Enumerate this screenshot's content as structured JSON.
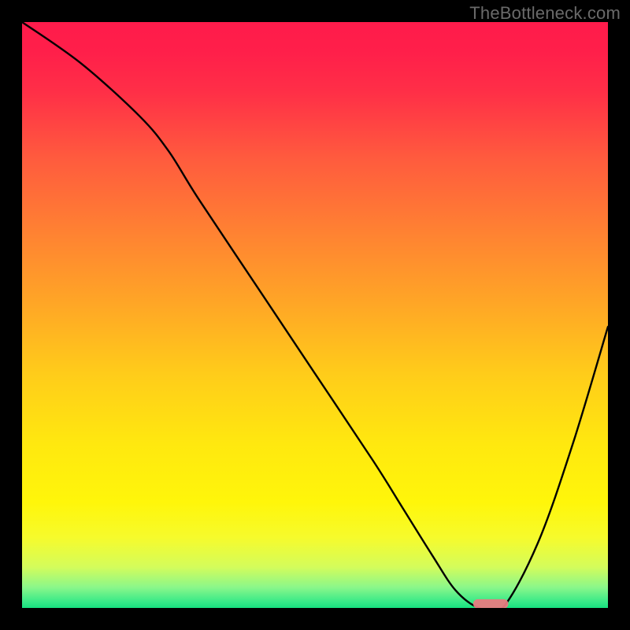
{
  "watermark": "TheBottleneck.com",
  "chart_data": {
    "type": "line",
    "title": "",
    "xlabel": "",
    "ylabel": "",
    "xlim": [
      0,
      100
    ],
    "ylim": [
      0,
      100
    ],
    "background_gradient": {
      "stops": [
        {
          "offset": 0.0,
          "color": "#ff1b4b"
        },
        {
          "offset": 0.05,
          "color": "#ff1f4a"
        },
        {
          "offset": 0.12,
          "color": "#ff2f47"
        },
        {
          "offset": 0.23,
          "color": "#ff5a3e"
        },
        {
          "offset": 0.35,
          "color": "#ff7f33"
        },
        {
          "offset": 0.48,
          "color": "#ffa626"
        },
        {
          "offset": 0.6,
          "color": "#ffcc1a"
        },
        {
          "offset": 0.72,
          "color": "#ffe80f"
        },
        {
          "offset": 0.82,
          "color": "#fff60a"
        },
        {
          "offset": 0.88,
          "color": "#f6fb2c"
        },
        {
          "offset": 0.93,
          "color": "#d4fc5b"
        },
        {
          "offset": 0.965,
          "color": "#8af78a"
        },
        {
          "offset": 0.99,
          "color": "#36e988"
        },
        {
          "offset": 1.0,
          "color": "#17e07f"
        }
      ]
    },
    "series": [
      {
        "name": "bottleneck-curve",
        "color": "#000000",
        "x": [
          0,
          10,
          20,
          25,
          30,
          40,
          50,
          60,
          65,
          70,
          74,
          78,
          82,
          88,
          94,
          100
        ],
        "y": [
          100,
          93,
          84,
          78,
          70,
          55,
          40,
          25,
          17,
          9,
          3,
          0,
          0,
          11,
          28,
          48
        ]
      }
    ],
    "marker": {
      "name": "optimal-range",
      "x": 80,
      "y": 0.7,
      "width": 6,
      "height": 1.6,
      "color": "#e77a7f"
    }
  }
}
